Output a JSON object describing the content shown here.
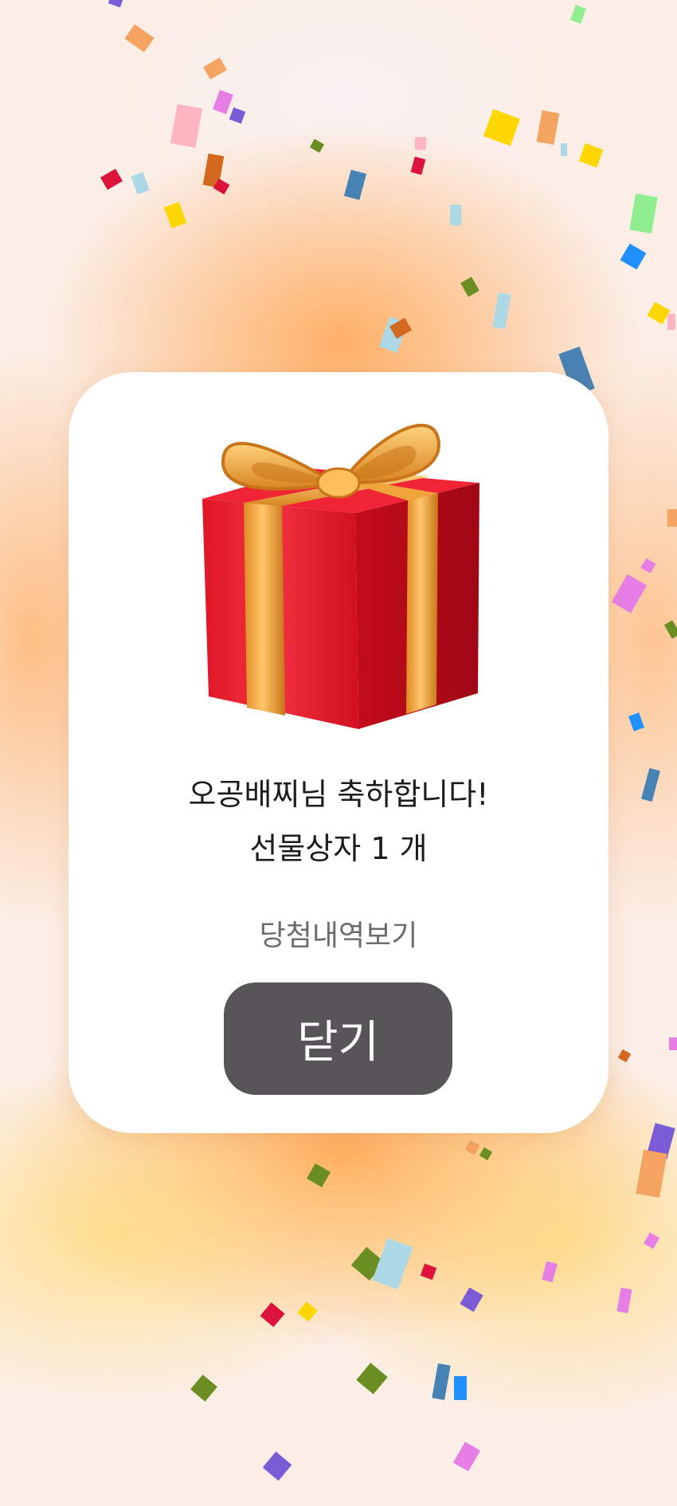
{
  "dialog": {
    "congrats_line": "오공배찌님 축하합니다!",
    "prize_line": "선물상자 1 개",
    "history_link": "당첨내역보기",
    "close_label": "닫기"
  },
  "icons": {
    "prize": "gift-box-icon"
  },
  "colors": {
    "close_button": "#575557",
    "gift_red": "#e3202e",
    "ribbon_gold": "#f0a53a",
    "card_background": "#ffffff"
  }
}
